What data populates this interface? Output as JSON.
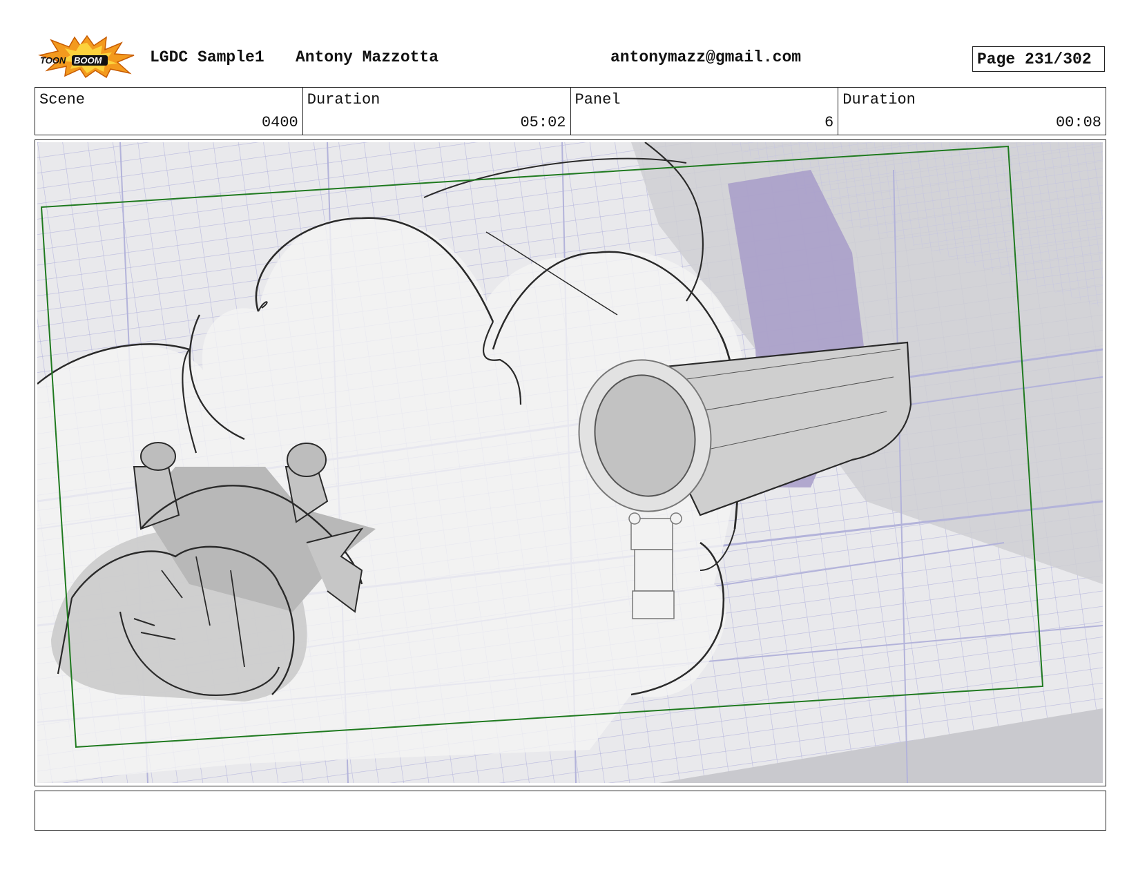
{
  "header": {
    "logo_text_left": "TOON",
    "logo_text_right": "BOOM",
    "project": "LGDC Sample1",
    "author": "Antony Mazzotta",
    "email": "antonymazz@gmail.com",
    "page": "Page 231/302"
  },
  "info": {
    "scene_label": "Scene",
    "scene_value": "0400",
    "scene_duration_label": "Duration",
    "scene_duration_value": "05:02",
    "panel_label": "Panel",
    "panel_value": "6",
    "panel_duration_label": "Duration",
    "panel_duration_value": "00:08"
  },
  "panel_image": {
    "description_icon": "storyboard-sketch",
    "colors": {
      "wireframe": "#b3b3da",
      "camera_frame": "#1f7a1f",
      "shadow_purple": "#a79cc9",
      "sketch": "#2a2a2a",
      "fill_gray": "#bdbdbd"
    }
  },
  "notes": {
    "text": ""
  }
}
